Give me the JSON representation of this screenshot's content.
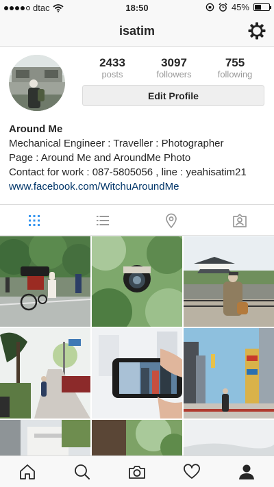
{
  "status_bar": {
    "carrier": "dtac",
    "time": "18:50",
    "battery": "45%",
    "battery_level": 0.45
  },
  "header": {
    "username": "isatim",
    "settings_icon": "gear-icon"
  },
  "profile": {
    "stats": [
      {
        "value": "2433",
        "label": "posts"
      },
      {
        "value": "3097",
        "label": "followers"
      },
      {
        "value": "755",
        "label": "following"
      }
    ],
    "edit_label": "Edit Profile"
  },
  "bio": {
    "name": "Around Me",
    "lines": [
      "Mechanical Engineer : Traveller : Photographer",
      "Page : Around Me and AroundMe Photo",
      "Contact for work : 087-5805056 , line : yeahisatim21"
    ],
    "link": "www.facebook.com/WitchuAroundMe"
  },
  "view_tabs": [
    {
      "icon": "grid-icon",
      "active": true
    },
    {
      "icon": "list-icon",
      "active": false
    },
    {
      "icon": "location-pin-icon",
      "active": false
    },
    {
      "icon": "tagged-icon",
      "active": false
    }
  ],
  "posts": [
    {
      "subject": "rickshaw-street"
    },
    {
      "subject": "camera-in-leaves"
    },
    {
      "subject": "castle-photographer"
    },
    {
      "subject": "tree-lined-path"
    },
    {
      "subject": "phone-photo"
    },
    {
      "subject": "city-street-signs"
    },
    {
      "subject": "building"
    },
    {
      "subject": "greenery"
    },
    {
      "subject": "sky"
    }
  ],
  "tab_bar": [
    {
      "icon": "home-icon"
    },
    {
      "icon": "search-icon"
    },
    {
      "icon": "camera-icon"
    },
    {
      "icon": "heart-icon"
    },
    {
      "icon": "profile-icon",
      "active": true
    }
  ],
  "colors": {
    "link": "#003569",
    "active_tab": "#3897f0",
    "muted_label": "#999999",
    "border": "#dbdbdb"
  }
}
